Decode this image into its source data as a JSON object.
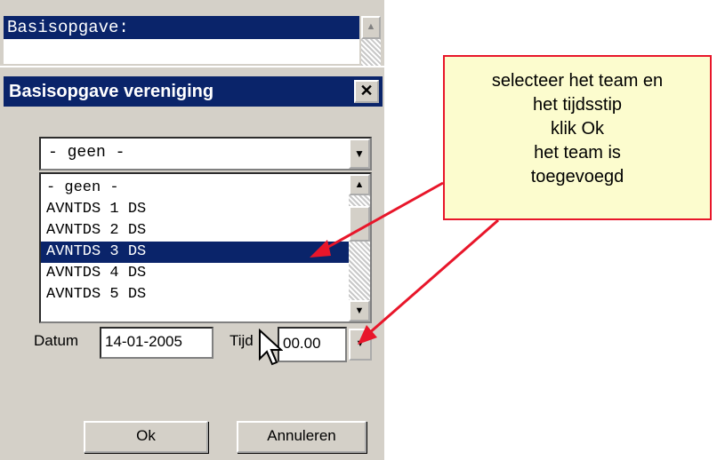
{
  "background_window": {
    "title": "Basisopgave:"
  },
  "dialog": {
    "title": "Basisopgave vereniging",
    "close_label": "✕",
    "combo_value": "- geen -",
    "list_items": [
      {
        "label": "- geen -",
        "selected": false
      },
      {
        "label": "AVNTDS 1 DS",
        "selected": false
      },
      {
        "label": "AVNTDS 2 DS",
        "selected": false
      },
      {
        "label": "AVNTDS 3 DS",
        "selected": true
      },
      {
        "label": "AVNTDS 4 DS",
        "selected": false
      },
      {
        "label": "AVNTDS 5 DS",
        "selected": false
      }
    ],
    "datum_label": "Datum",
    "datum_value": "14-01-2005",
    "tijd_label": "Tijd",
    "tijd_value": "00.00",
    "ok_label": "Ok",
    "cancel_label": "Annuleren"
  },
  "callout": {
    "lines": [
      "selecteer het team en",
      "het tijdsstip",
      "klik Ok",
      "het team is",
      "toegevoegd"
    ]
  },
  "colors": {
    "title_bar": "#0a246a",
    "dialog_bg": "#d4d0c8",
    "callout_bg": "#fcfcce",
    "callout_border": "#e8162a",
    "arrow": "#e8162a"
  },
  "icons": {
    "close": "close-icon",
    "dropdown": "chevron-down-icon",
    "scroll_up": "scroll-up-icon",
    "scroll_down": "scroll-down-icon",
    "cursor": "mouse-pointer-icon"
  }
}
